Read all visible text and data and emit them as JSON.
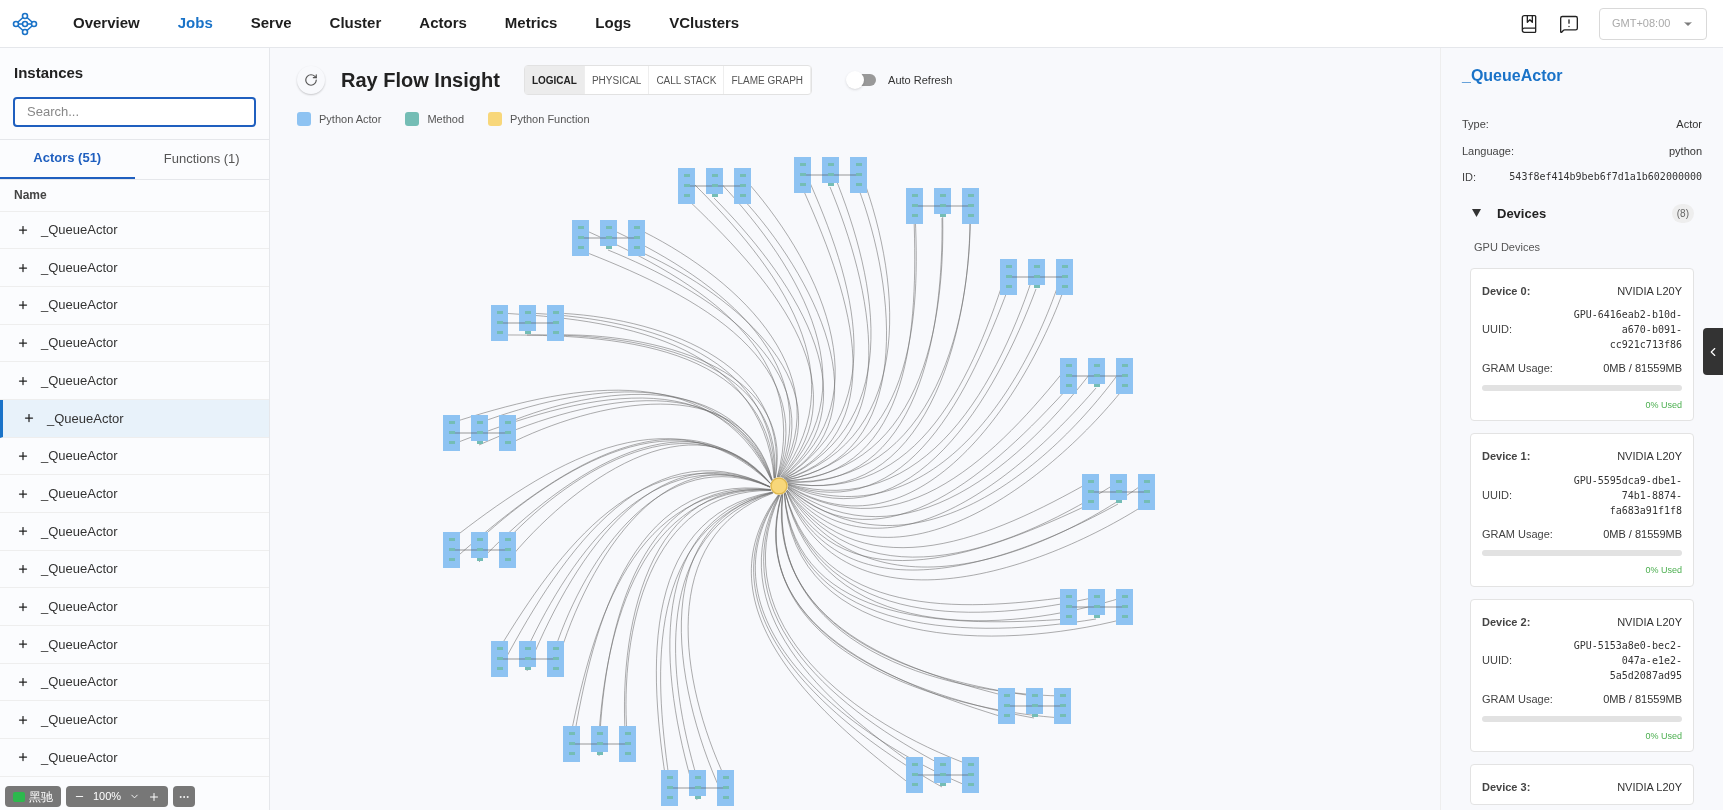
{
  "nav": {
    "items": [
      {
        "label": "Overview",
        "selected": false
      },
      {
        "label": "Jobs",
        "selected": true
      },
      {
        "label": "Serve",
        "selected": false
      },
      {
        "label": "Cluster",
        "selected": false
      },
      {
        "label": "Actors",
        "selected": false
      },
      {
        "label": "Metrics",
        "selected": false
      },
      {
        "label": "Logs",
        "selected": false
      },
      {
        "label": "VClusters",
        "selected": false
      }
    ],
    "timezone": "GMT+08:00"
  },
  "instances": {
    "title": "Instances",
    "search_placeholder": "Search...",
    "tabs": [
      {
        "label": "Actors (51)",
        "selected": true
      },
      {
        "label": "Functions (1)",
        "selected": false
      }
    ],
    "column": "Name",
    "rows": [
      {
        "name": "_QueueActor",
        "selected": false
      },
      {
        "name": "_QueueActor",
        "selected": false
      },
      {
        "name": "_QueueActor",
        "selected": false
      },
      {
        "name": "_QueueActor",
        "selected": false
      },
      {
        "name": "_QueueActor",
        "selected": false
      },
      {
        "name": "_QueueActor",
        "selected": true
      },
      {
        "name": "_QueueActor",
        "selected": false
      },
      {
        "name": "_QueueActor",
        "selected": false
      },
      {
        "name": "_QueueActor",
        "selected": false
      },
      {
        "name": "_QueueActor",
        "selected": false
      },
      {
        "name": "_QueueActor",
        "selected": false
      },
      {
        "name": "_QueueActor",
        "selected": false
      },
      {
        "name": "_QueueActor",
        "selected": false
      },
      {
        "name": "_QueueActor",
        "selected": false
      },
      {
        "name": "_QueueActor",
        "selected": false
      }
    ]
  },
  "flow": {
    "title": "Ray Flow Insight",
    "views": [
      {
        "label": "LOGICAL",
        "selected": true
      },
      {
        "label": "PHYSICAL",
        "selected": false
      },
      {
        "label": "CALL STACK",
        "selected": false
      },
      {
        "label": "FLAME GRAPH",
        "selected": false
      }
    ],
    "auto_refresh": {
      "label": "Auto Refresh",
      "on": false
    },
    "legend": [
      {
        "label": "Python Actor",
        "color": "#8ec3f2"
      },
      {
        "label": "Method",
        "color": "#74bdb5"
      },
      {
        "label": "Python Function",
        "color": "#f8d77a"
      }
    ]
  },
  "details": {
    "title": "_QueueActor",
    "fields": [
      {
        "label": "Type:",
        "value": "Actor",
        "kind": "text"
      },
      {
        "label": "Language:",
        "value": "python",
        "kind": "text"
      },
      {
        "label": "ID:",
        "value": "543f8ef414b9beb6f7d1a1b602000000",
        "kind": "code"
      }
    ],
    "devices": {
      "label": "Devices",
      "count": "(8)",
      "expanded": true,
      "group": "GPU Devices",
      "items": [
        {
          "name": "Device 0:",
          "model": "NVIDIA L20Y",
          "uuid_label": "UUID:",
          "uuid": "GPU-6416eab2-b10d-a670-b091-cc921c713f86",
          "usage_label": "GRAM Usage:",
          "usage": "0MB / 81559MB",
          "level": 0,
          "used": "0% Used"
        },
        {
          "name": "Device 1:",
          "model": "NVIDIA L20Y",
          "uuid_label": "UUID:",
          "uuid": "GPU-5595dca9-dbe1-74b1-8874-fa683a91f1f8",
          "usage_label": "GRAM Usage:",
          "usage": "0MB / 81559MB",
          "level": 0,
          "used": "0% Used"
        },
        {
          "name": "Device 2:",
          "model": "NVIDIA L20Y",
          "uuid_label": "UUID:",
          "uuid": "GPU-5153a8e0-bec2-047a-e1e2-5a5d2087ad95",
          "usage_label": "GRAM Usage:",
          "usage": "0MB / 81559MB",
          "level": 0,
          "used": "0% Used"
        },
        {
          "name": "Device 3:",
          "model": "NVIDIA L20Y"
        }
      ]
    }
  },
  "recorder": {
    "label": "黑驰",
    "zoom": "100%"
  }
}
